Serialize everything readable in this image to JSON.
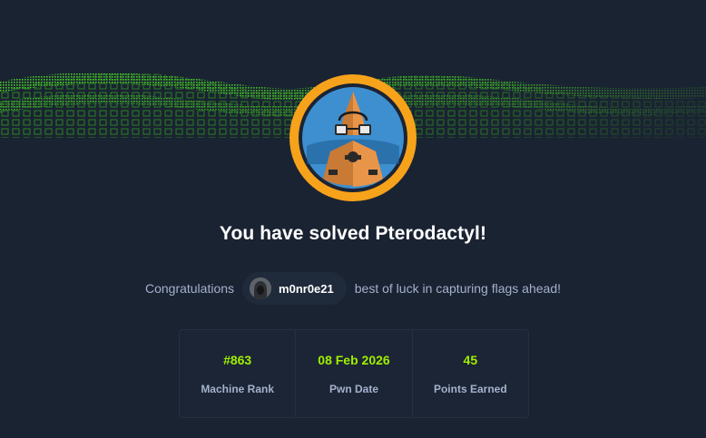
{
  "colors": {
    "background": "#1a2332",
    "accent_green": "#9fef00",
    "avatar_ring": "#f7a21b",
    "text_muted": "#a4b1cd"
  },
  "banner": {
    "icon": "green-wave-grid"
  },
  "machine": {
    "avatar_icon": "pterodactyl-robot-avatar"
  },
  "title": "You have solved Pterodactyl!",
  "congrats": {
    "prefix": "Congratulations",
    "username": "m0nr0e21",
    "suffix": "best of luck in capturing flags ahead!"
  },
  "stats": [
    {
      "value": "#863",
      "label": "Machine Rank"
    },
    {
      "value": "08 Feb 2026",
      "label": "Pwn Date"
    },
    {
      "value": "45",
      "label": "Points Earned"
    }
  ]
}
